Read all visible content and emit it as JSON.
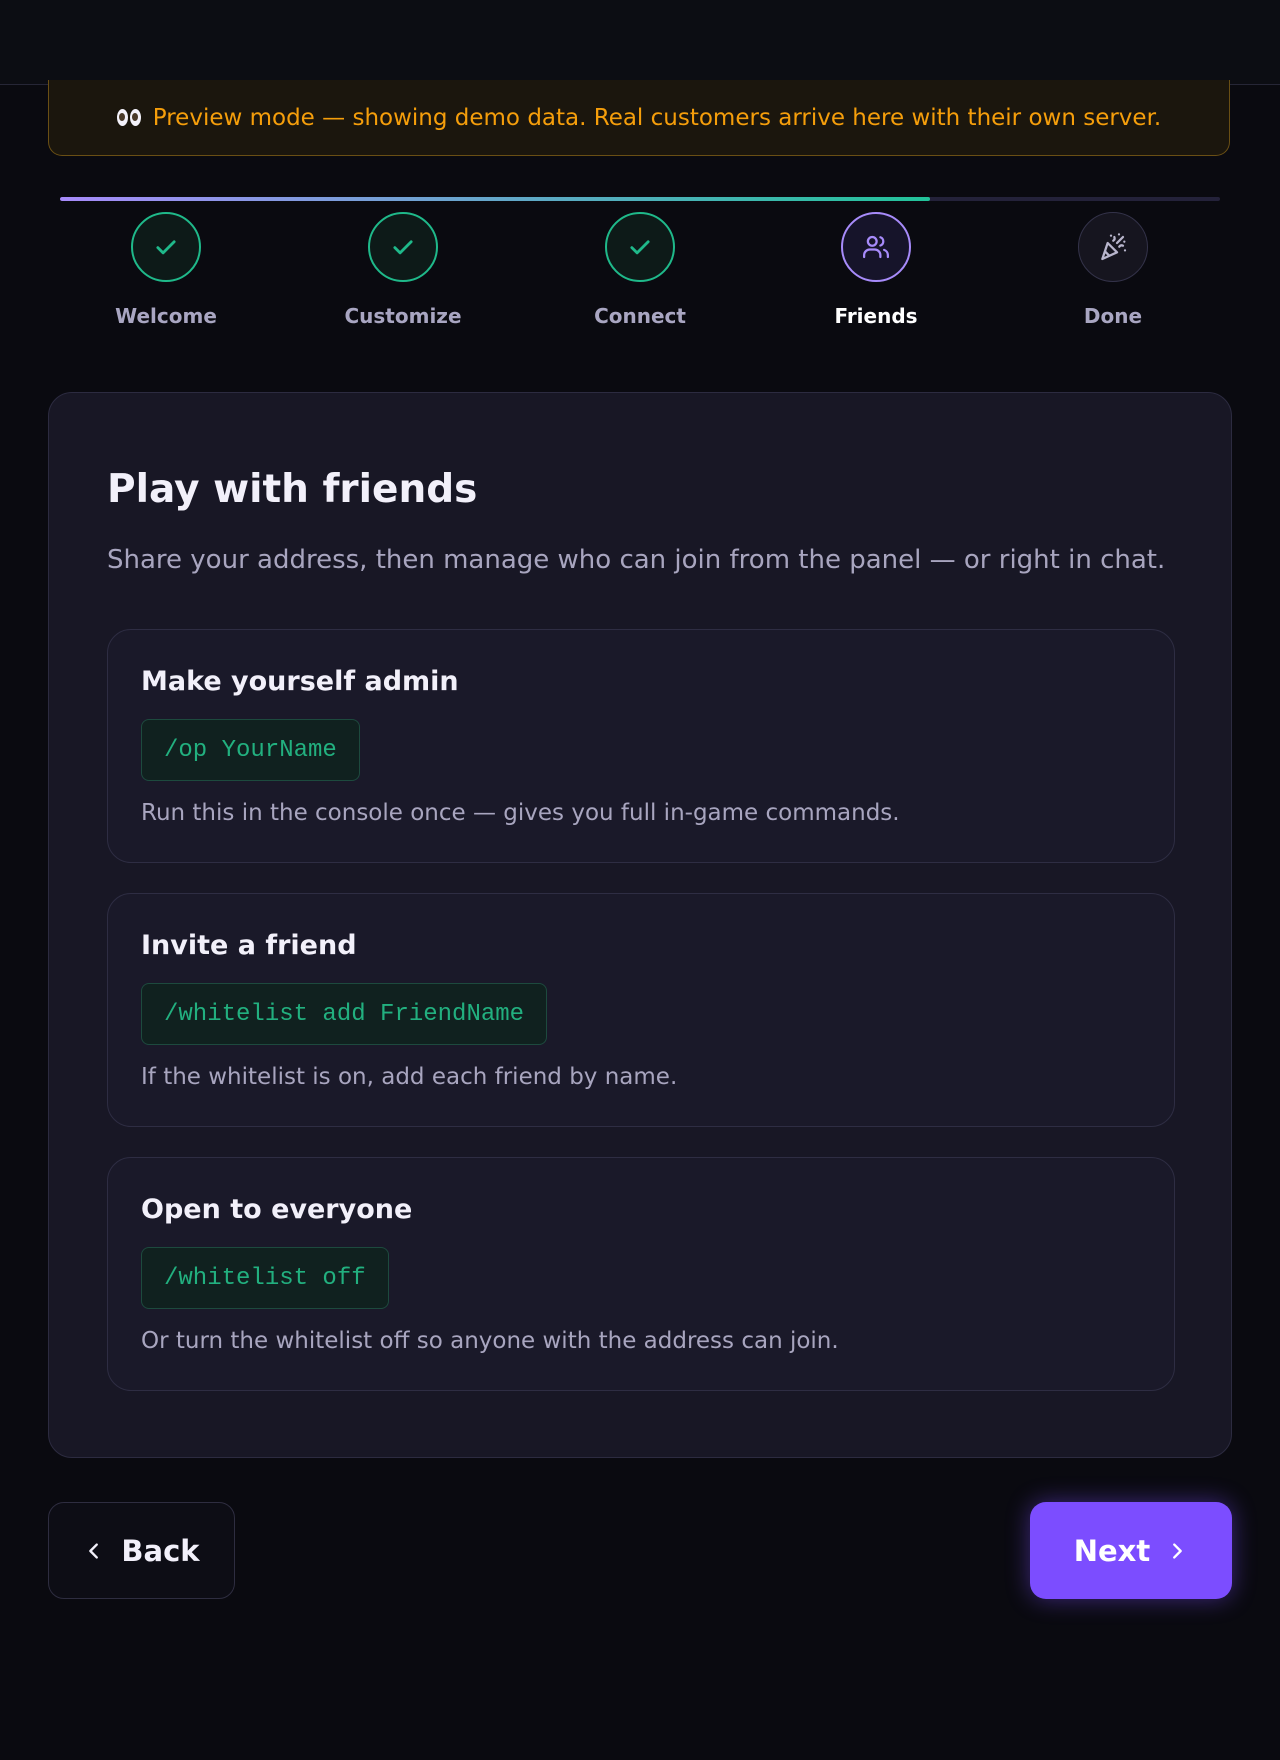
{
  "banner": {
    "icon": "eyes-icon",
    "text": "Preview mode — showing demo data. Real customers arrive here with their own server."
  },
  "progress": {
    "completed_fraction": 0.75
  },
  "steps": [
    {
      "label": "Welcome",
      "status": "done",
      "icon": "check-icon"
    },
    {
      "label": "Customize",
      "status": "done",
      "icon": "check-icon"
    },
    {
      "label": "Connect",
      "status": "done",
      "icon": "check-icon"
    },
    {
      "label": "Friends",
      "status": "current",
      "icon": "users-icon"
    },
    {
      "label": "Done",
      "status": "pending",
      "icon": "party-popper-icon"
    }
  ],
  "card": {
    "title": "Play with friends",
    "subtitle": "Share your address, then manage who can join from the panel — or right in chat.",
    "sections": [
      {
        "title": "Make yourself admin",
        "command": "/op YourName",
        "description": "Run this in the console once — gives you full in-game commands."
      },
      {
        "title": "Invite a friend",
        "command": "/whitelist add FriendName",
        "description": "If the whitelist is on, add each friend by name."
      },
      {
        "title": "Open to everyone",
        "command": "/whitelist off",
        "description": "Or turn the whitelist off so anyone with the address can join."
      }
    ]
  },
  "nav": {
    "back_label": "Back",
    "next_label": "Next"
  },
  "colors": {
    "accent": "#7c4dff",
    "success": "#1fb98a",
    "warning": "#f59e0b",
    "background": "#0a0a10"
  }
}
